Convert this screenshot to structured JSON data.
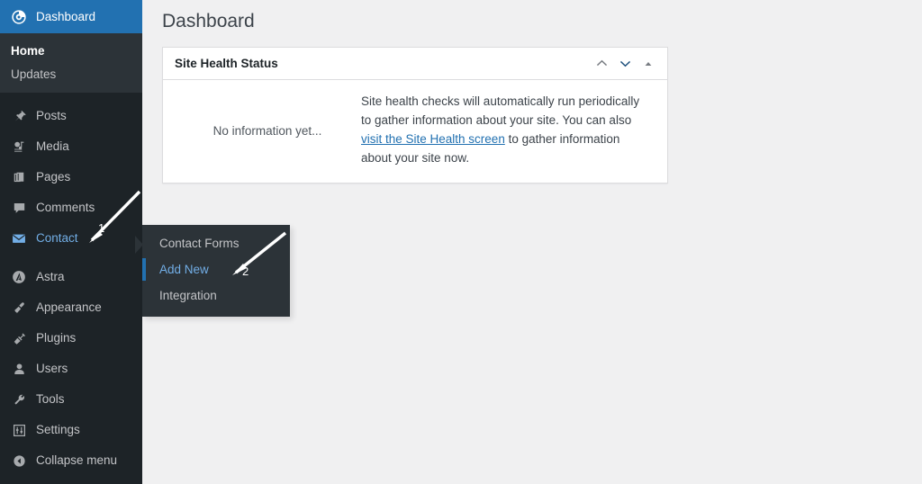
{
  "sidebar": {
    "current_item": "Dashboard",
    "accent_color": "#2271b1",
    "hover_color": "#72aee6",
    "background_color": "#1d2327",
    "submenu_background": "#2c3338",
    "dashboard": {
      "label": "Dashboard",
      "icon": "dashboard-gauge-icon",
      "submenu": [
        {
          "label": "Home",
          "icon": "",
          "current": true
        },
        {
          "label": "Updates",
          "icon": "",
          "current": false
        }
      ]
    },
    "items": [
      {
        "label": "Posts",
        "icon": "pushpin-icon",
        "state": "normal"
      },
      {
        "label": "Media",
        "icon": "media-camera-icon",
        "state": "normal"
      },
      {
        "label": "Pages",
        "icon": "pages-stack-icon",
        "state": "normal"
      },
      {
        "label": "Comments",
        "icon": "comment-bubble-icon",
        "state": "normal"
      },
      {
        "label": "Contact",
        "icon": "envelope-icon",
        "state": "hover"
      },
      {
        "label": "Astra",
        "icon": "astra-logo-icon",
        "state": "normal"
      },
      {
        "label": "Appearance",
        "icon": "paintbrush-icon",
        "state": "normal"
      },
      {
        "label": "Plugins",
        "icon": "plug-icon",
        "state": "normal"
      },
      {
        "label": "Users",
        "icon": "user-icon",
        "state": "normal"
      },
      {
        "label": "Tools",
        "icon": "wrench-icon",
        "state": "normal"
      },
      {
        "label": "Settings",
        "icon": "sliders-icon",
        "state": "normal"
      }
    ],
    "collapse": {
      "label": "Collapse menu",
      "icon": "collapse-arrow-icon"
    }
  },
  "flyout": {
    "title": "Contact",
    "items": [
      {
        "label": "Contact Forms",
        "current": false
      },
      {
        "label": "Add New",
        "current": true
      },
      {
        "label": "Integration",
        "current": false
      }
    ]
  },
  "main": {
    "page_title": "Dashboard",
    "site_health": {
      "title": "Site Health Status",
      "status_text": "No information yet...",
      "description_before": "Site health checks will automatically run periodically to gather information about your site. You can also ",
      "link_text": "visit the Site Health screen",
      "description_after": " to gather information about your site now.",
      "controls": [
        {
          "name": "move-up",
          "icon": "chevron-up-icon"
        },
        {
          "name": "move-down",
          "icon": "chevron-down-icon"
        },
        {
          "name": "toggle",
          "icon": "triangle-up-icon"
        }
      ]
    }
  },
  "annotations": [
    {
      "number": "1",
      "target": "Contact"
    },
    {
      "number": "2",
      "target": "Add New"
    }
  ]
}
